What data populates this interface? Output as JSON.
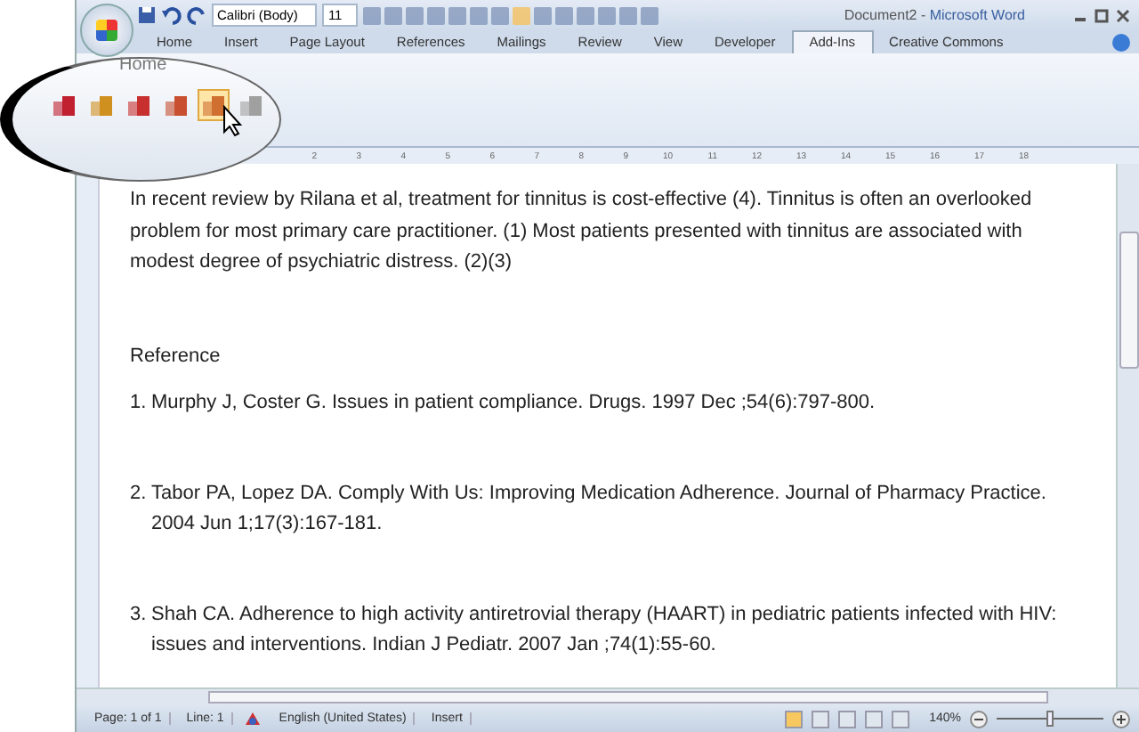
{
  "window": {
    "document": "Document2",
    "separator": "-",
    "app": "Microsoft Word"
  },
  "quick_access": {
    "font": "Calibri (Body)",
    "size": "11"
  },
  "tabs": [
    {
      "label": "Home",
      "selected": false
    },
    {
      "label": "Insert",
      "selected": false
    },
    {
      "label": "Page Layout",
      "selected": false
    },
    {
      "label": "References",
      "selected": false
    },
    {
      "label": "Mailings",
      "selected": false
    },
    {
      "label": "Review",
      "selected": false
    },
    {
      "label": "View",
      "selected": false
    },
    {
      "label": "Developer",
      "selected": false
    },
    {
      "label": "Add-Ins",
      "selected": true
    },
    {
      "label": "Creative Commons",
      "selected": false
    }
  ],
  "callout": {
    "tab_label": "Home",
    "buttons": [
      {
        "kind": "cite",
        "selected": false
      },
      {
        "kind": "edit",
        "selected": false
      },
      {
        "kind": "block",
        "selected": false
      },
      {
        "kind": "block-edit",
        "selected": false
      },
      {
        "kind": "convert",
        "selected": true
      },
      {
        "kind": "settings",
        "selected": false
      }
    ]
  },
  "ruler": [
    "2",
    "3",
    "4",
    "5",
    "6",
    "7",
    "8",
    "9",
    "10",
    "11",
    "12",
    "13",
    "14",
    "15",
    "16",
    "17",
    "18"
  ],
  "document": {
    "paragraph": "In recent review by Rilana et al, treatment for tinnitus is cost-effective (4). Tinnitus is often an overlooked problem for most primary care practitioner. (1) Most patients presented with tinnitus are associated with modest degree of psychiatric distress. (2)(3)",
    "heading": "Reference",
    "references": [
      {
        "number": "1.",
        "text": "Murphy J, Coster G. Issues in patient compliance. Drugs. 1997 Dec ;54(6):797-800."
      },
      {
        "number": "2.",
        "text": "Tabor PA, Lopez DA. Comply With Us: Improving Medication Adherence. Journal of Pharmacy Practice. 2004 Jun 1;17(3):167-181."
      },
      {
        "number": "3.",
        "text": "Shah CA. Adherence to high activity antiretrovial therapy (HAART) in pediatric patients infected with HIV: issues and interventions. Indian J Pediatr. 2007 Jan ;74(1):55-60."
      }
    ]
  },
  "status_bar": {
    "page": "Page: 1 of 1",
    "line": "Line: 1",
    "language": "English (United States)",
    "mode": "Insert",
    "views": [
      {
        "selected": true
      },
      {
        "selected": false
      },
      {
        "selected": false
      },
      {
        "selected": false
      },
      {
        "selected": false
      }
    ],
    "zoom": "140%",
    "zoom_level": {
      "level": 0.5
    }
  }
}
